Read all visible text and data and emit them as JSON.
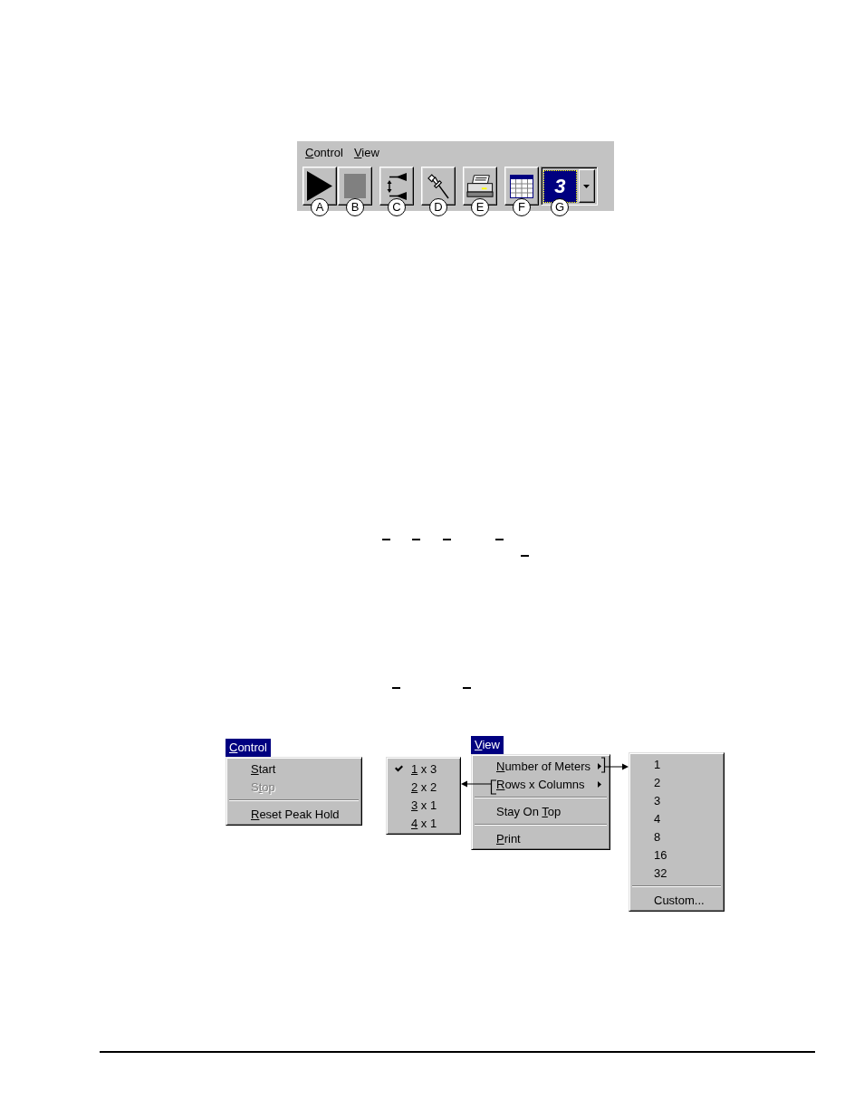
{
  "toolbar": {
    "menu_bar": [
      {
        "key": "C",
        "post": "ontrol",
        "selected": false
      },
      {
        "key": "V",
        "post": "iew",
        "selected": false
      }
    ],
    "tool_groups": [
      [
        {
          "kind": "play",
          "callout": "A"
        },
        {
          "kind": "stop",
          "callout": "B"
        }
      ],
      [
        {
          "kind": "range_markers",
          "callout": "C"
        }
      ],
      [
        {
          "kind": "pin",
          "callout": "D"
        }
      ],
      [
        {
          "kind": "print",
          "callout": "E"
        }
      ],
      [
        {
          "kind": "grid",
          "callout": "F"
        },
        {
          "kind": "meter_count",
          "value": "3",
          "callout": "G"
        }
      ]
    ]
  },
  "menus": [
    {
      "kind": "menu",
      "title": {
        "key": "C",
        "post": "ontrol",
        "selected": true
      },
      "items": [
        {
          "kind": "item",
          "key": "S",
          "post": "tart",
          "disabled": false
        },
        {
          "kind": "item",
          "pre": "S",
          "key": "t",
          "post": "op",
          "disabled": true
        },
        {
          "kind": "separator"
        },
        {
          "kind": "item",
          "key": "R",
          "post": "eset Peak Hold",
          "disabled": false
        }
      ]
    },
    {
      "kind": "submenu",
      "items": [
        {
          "kind": "item",
          "key": "1",
          "post": " x 3",
          "checked": true
        },
        {
          "kind": "item",
          "key": "2",
          "post": " x 2",
          "checked": false
        },
        {
          "kind": "item",
          "key": "3",
          "post": " x 1",
          "checked": false
        },
        {
          "kind": "item",
          "key": "4",
          "post": " x 1",
          "checked": false
        }
      ]
    },
    {
      "kind": "menu",
      "title": {
        "key": "V",
        "post": "iew",
        "selected": true
      },
      "items": [
        {
          "kind": "item",
          "key": "N",
          "post": "umber of Meters",
          "submenu": true
        },
        {
          "kind": "item",
          "key": "R",
          "post": "ows x Columns",
          "submenu": true
        },
        {
          "kind": "separator"
        },
        {
          "kind": "item",
          "pre": "Stay On ",
          "key": "T",
          "post": "op",
          "submenu": false
        },
        {
          "kind": "separator"
        },
        {
          "kind": "item",
          "key": "P",
          "post": "rint",
          "submenu": false
        }
      ]
    },
    {
      "kind": "submenu",
      "items": [
        {
          "kind": "item",
          "label": "1"
        },
        {
          "kind": "item",
          "label": "2"
        },
        {
          "kind": "item",
          "label": "3"
        },
        {
          "kind": "item",
          "label": "4"
        },
        {
          "kind": "item",
          "label": "8"
        },
        {
          "kind": "item",
          "label": "16"
        },
        {
          "kind": "item",
          "label": "32"
        },
        {
          "kind": "separator"
        },
        {
          "kind": "item",
          "label": "Custom..."
        }
      ]
    }
  ]
}
